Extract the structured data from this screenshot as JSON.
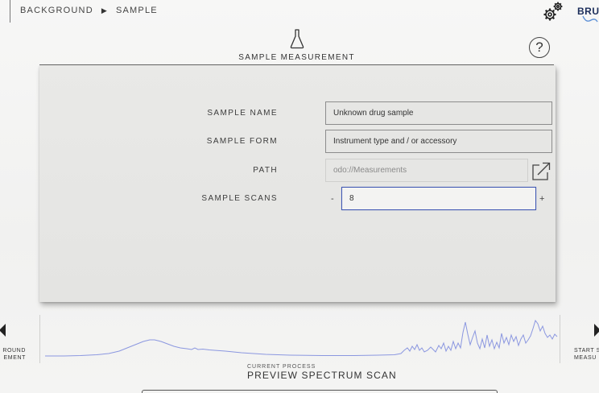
{
  "breadcrumb": {
    "items": [
      "BACKGROUND",
      "SAMPLE"
    ],
    "separator": "▶"
  },
  "header": {
    "brand": "BRU"
  },
  "panel": {
    "title": "SAMPLE MEASUREMENT",
    "help_label": "?",
    "fields": {
      "sample_name": {
        "label": "SAMPLE NAME",
        "value": "Unknown drug sample"
      },
      "sample_form": {
        "label": "SAMPLE FORM",
        "value": "Instrument type and / or accessory"
      },
      "path": {
        "label": "PATH",
        "value": "odo://Measurements"
      },
      "sample_scans": {
        "label": "SAMPLE SCANS",
        "value": "8",
        "decrement": "-",
        "increment": "+"
      }
    }
  },
  "footer": {
    "nav_left_label": "ROUND\nEMENT",
    "nav_right_label": "START S\nMEASU",
    "current_process_label": "CURRENT PROCESS",
    "current_process": "PREVIEW SPECTRUM SCAN"
  },
  "colors": {
    "accent": "#3f57b3",
    "spectrum": "#8b97e0",
    "brand": "#1b2d5a"
  },
  "icons": [
    "gear-icon",
    "flask-icon",
    "help-icon",
    "external-link-icon",
    "arrow-left-icon",
    "arrow-right-icon"
  ]
}
